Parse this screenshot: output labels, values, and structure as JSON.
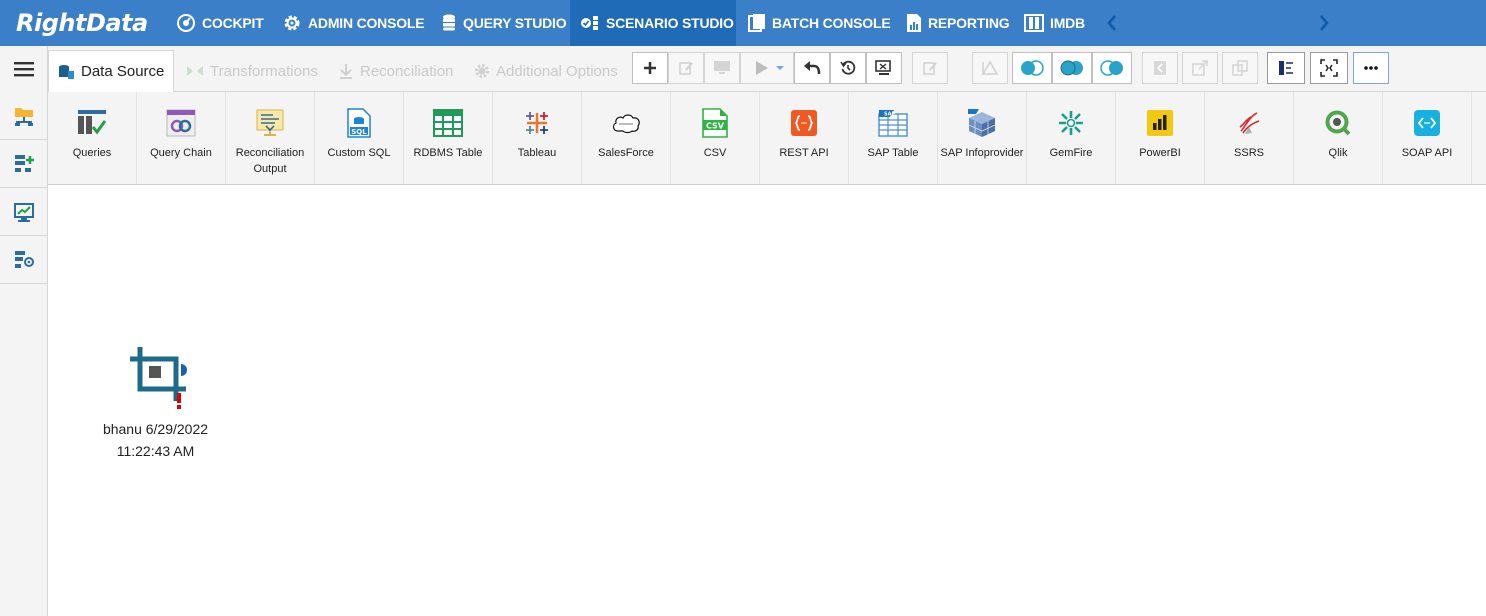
{
  "app": {
    "logo": "RightData"
  },
  "nav": {
    "items": [
      {
        "label": "COCKPIT",
        "icon": "cockpit-icon"
      },
      {
        "label": "ADMIN CONSOLE",
        "icon": "gear-icon"
      },
      {
        "label": "QUERY STUDIO",
        "icon": "database-icon"
      },
      {
        "label": "SCENARIO STUDIO",
        "icon": "scenario-icon",
        "active": true
      },
      {
        "label": "BATCH CONSOLE",
        "icon": "batch-icon"
      },
      {
        "label": "REPORTING",
        "icon": "report-icon"
      },
      {
        "label": "IMDB",
        "icon": "imdb-icon"
      }
    ]
  },
  "tabs": [
    {
      "label": "Data Source",
      "active": true
    },
    {
      "label": "Transformations",
      "active": false
    },
    {
      "label": "Reconciliation",
      "active": false
    },
    {
      "label": "Additional Options",
      "active": false
    }
  ],
  "connectors": [
    {
      "label": "Queries",
      "icon": "queries-icon"
    },
    {
      "label": "Query Chain",
      "icon": "query-chain-icon"
    },
    {
      "label": "Reconciliation Output",
      "icon": "reconciliation-output-icon"
    },
    {
      "label": "Custom SQL",
      "icon": "sql-icon"
    },
    {
      "label": "RDBMS Table",
      "icon": "rdbms-table-icon"
    },
    {
      "label": "Tableau",
      "icon": "tableau-icon"
    },
    {
      "label": "SalesForce",
      "icon": "salesforce-icon"
    },
    {
      "label": "CSV",
      "icon": "csv-icon"
    },
    {
      "label": "REST API",
      "icon": "rest-api-icon"
    },
    {
      "label": "SAP Table",
      "icon": "sap-table-icon"
    },
    {
      "label": "SAP Infoprovider",
      "icon": "sap-infoprovider-icon"
    },
    {
      "label": "GemFire",
      "icon": "gemfire-icon"
    },
    {
      "label": "PowerBI",
      "icon": "powerbi-icon"
    },
    {
      "label": "SSRS",
      "icon": "ssrs-icon"
    },
    {
      "label": "Qlik",
      "icon": "qlik-icon"
    },
    {
      "label": "SOAP API",
      "icon": "soap-api-icon"
    }
  ],
  "canvas": {
    "node": {
      "line1": "bhanu 6/29/2022",
      "line2": "11:22:43 AM",
      "warning": "!"
    }
  },
  "colors": {
    "nav_bg": "#3a7fc7",
    "nav_active": "#1f6bb8",
    "node": "#1d6a8c",
    "warning": "#e00000"
  }
}
